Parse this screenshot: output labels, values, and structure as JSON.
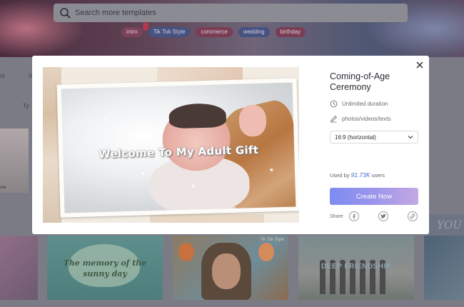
{
  "search": {
    "placeholder": "Search more templates"
  },
  "tags": [
    "intro",
    "Tik Tok Style",
    "commerce",
    "wedding",
    "birthday"
  ],
  "background_fragments": {
    "left_label_1": "ot",
    "left_label_2": "Ty",
    "left_label_3": "me",
    "left_label_4": "V"
  },
  "cards": {
    "card2_caption_line1": "The memory of the",
    "card2_caption_line2": "sunny day",
    "card3_label": "Tik Tok Style",
    "card4_caption": "DEEP FRIENDSHIP",
    "card5_text": "YOU"
  },
  "modal": {
    "preview_title": "Welcome To My Adult Gift",
    "title": "Coming-of-Age Ceremony",
    "duration": "Unlimited duration",
    "media": "photos/videos/texts",
    "aspect_select": "16:9 (horizontal)",
    "used_by_prefix": "Used by",
    "used_by_count": "91.73K",
    "used_by_suffix": "users",
    "create_button": "Create Now",
    "share_label": "Share"
  },
  "colors": {
    "accent_gradient_start": "#7d8cf0",
    "accent_gradient_end": "#c4a8e3",
    "used_count": "#3e6ed1"
  }
}
